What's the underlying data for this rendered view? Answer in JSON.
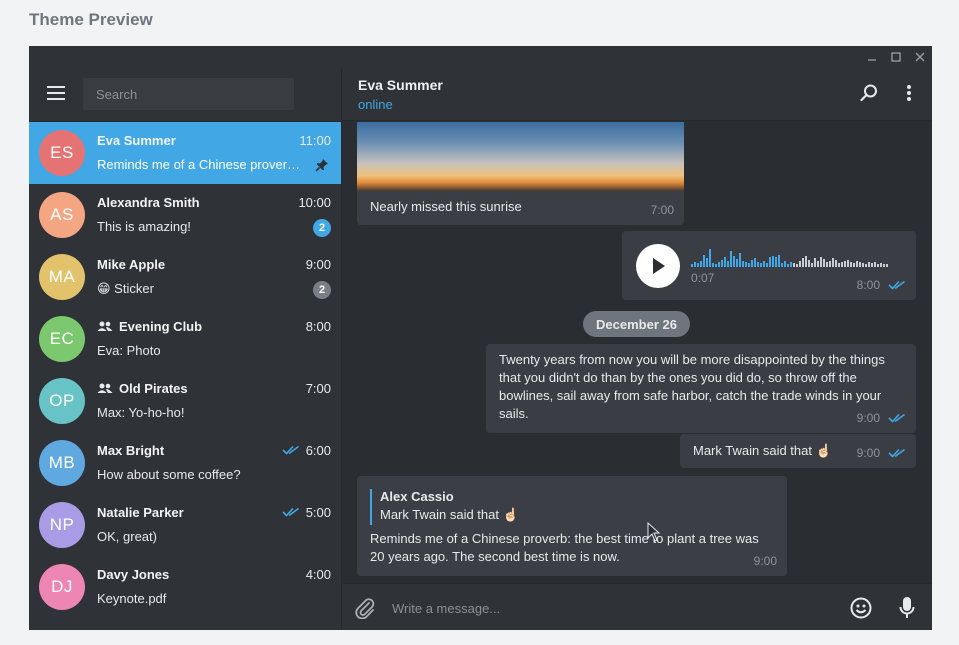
{
  "page_title": "Theme Preview",
  "search": {
    "placeholder": "Search"
  },
  "chats": [
    {
      "initials": "ES",
      "name": "Eva Summer",
      "time": "11:00",
      "preview": "Reminds me of a Chinese proverb: the best time to plant a tree",
      "avatar_color": "#e57373",
      "active": true,
      "pinned": true
    },
    {
      "initials": "AS",
      "name": "Alexandra Smith",
      "time": "10:00",
      "preview": "This is amazing!",
      "avatar_color": "#f4a582",
      "badge": "2",
      "badge_color": "#41a8e5"
    },
    {
      "initials": "MA",
      "name": "Mike Apple",
      "time": "9:00",
      "preview": "😁 Sticker",
      "avatar_color": "#e2c26b",
      "badge": "2",
      "badge_color": "#7a7f85"
    },
    {
      "initials": "EC",
      "name": "Evening Club",
      "time": "8:00",
      "preview": "Eva: Photo",
      "avatar_color": "#7cc86e",
      "group": true
    },
    {
      "initials": "OP",
      "name": "Old Pirates",
      "time": "7:00",
      "preview": "Max: Yo-ho-ho!",
      "avatar_color": "#67c3c6",
      "group": true
    },
    {
      "initials": "MB",
      "name": "Max Bright",
      "time": "6:00",
      "preview": "How about some coffee?",
      "avatar_color": "#5fa9e0",
      "read": true
    },
    {
      "initials": "NP",
      "name": "Natalie Parker",
      "time": "5:00",
      "preview": "OK, great)",
      "avatar_color": "#a99be6",
      "read": true
    },
    {
      "initials": "DJ",
      "name": "Davy Jones",
      "time": "4:00",
      "preview": "Keynote.pdf",
      "avatar_color": "#ee86b4"
    }
  ],
  "peer": {
    "name": "Eva Summer",
    "status": "online"
  },
  "messages": {
    "photo_caption": "Nearly missed this sunrise",
    "photo_time": "7:00",
    "voice_duration": "0:07",
    "voice_time": "8:00",
    "date_label": "December 26",
    "quote_text": "Twenty years from now you will be more disappointed by the things that you didn't do than by the ones you did do, so throw off the bowlines, sail away from safe harbor, catch the trade winds in your sails.",
    "quote_time": "9:00",
    "twain_text": "Mark Twain said that ☝🏻",
    "twain_time": "9:00",
    "reply_author": "Alex Cassio",
    "reply_quote": "Mark Twain said that ☝🏻",
    "reply_text": "Reminds me of a Chinese proverb: the best time to plant a tree was 20 years ago. The second best time is now.",
    "reply_time": "9:00"
  },
  "composer": {
    "placeholder": "Write a message..."
  },
  "colors": {
    "accent": "#41a8e5",
    "background": "#2a2d31",
    "panel": "#2f3237"
  }
}
